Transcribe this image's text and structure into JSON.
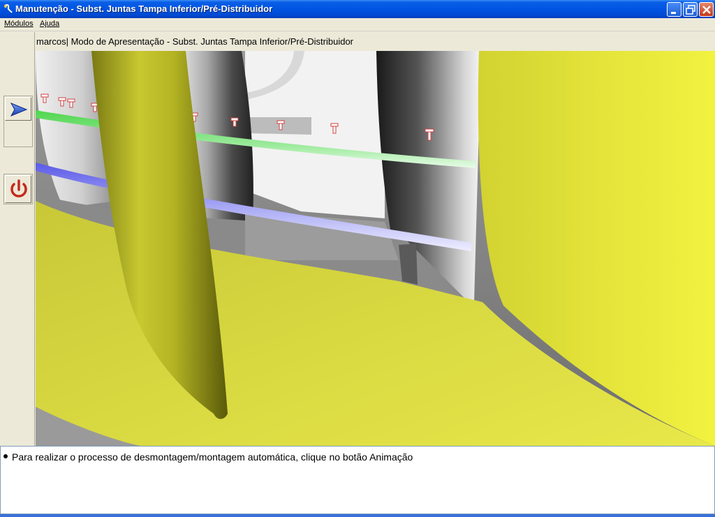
{
  "window": {
    "title": "Manutenção - Subst. Juntas Tampa Inferior/Pré-Distribuidor"
  },
  "menu": {
    "items": [
      {
        "label": "Módulos"
      },
      {
        "label": "Ajuda"
      }
    ]
  },
  "header": {
    "text": "marcos| Modo de Apresentação - Subst. Juntas Tampa Inferior/Pré-Distribuidor"
  },
  "toolbar": {
    "buttons": [
      {
        "icon": "play-arrow-icon"
      },
      {
        "icon": "power-icon"
      }
    ]
  },
  "message": {
    "text": "Para realizar o processo de desmontagem/montagem automática, clique no botão Animação"
  },
  "colors": {
    "titlebar_blue": "#0054e3",
    "yellow_surface": "#e6e63a",
    "green_ring": "#4fd64f",
    "blue_ring": "#6b6bf0",
    "power_red": "#c42a1a",
    "play_blue": "#1f4fc7"
  }
}
